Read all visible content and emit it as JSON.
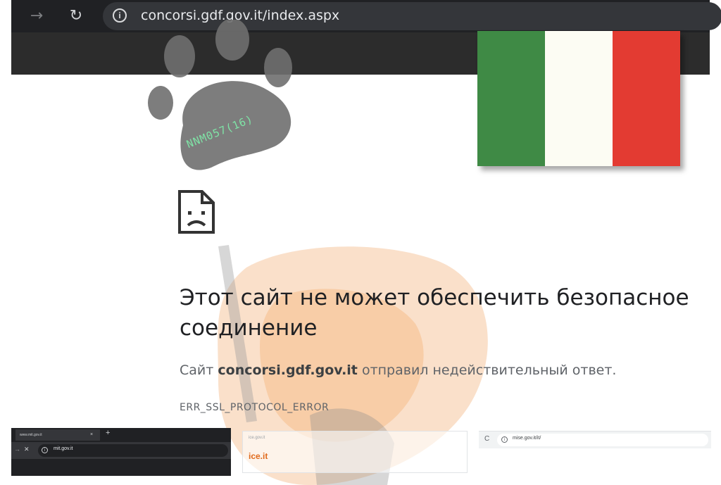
{
  "browser": {
    "url": "concorsi.gdf.gov.it/index.aspx",
    "info_glyph": "i",
    "forward_glyph": "→",
    "reload_glyph": "↻"
  },
  "watermark": {
    "code": "NNM057(16)",
    "paw_color": "#6f6f6f"
  },
  "flag": {
    "colors": [
      "#3f8a45",
      "#fcfcf3",
      "#e33b32"
    ]
  },
  "error_page": {
    "icon": "sad-page-icon",
    "title": "Этот сайт не может обеспечить безопасное соединение",
    "desc_prefix": "Сайт ",
    "desc_host": "concorsi.gdf.gov.it",
    "desc_suffix": " отправил недействительный ответ.",
    "error_code": "ERR_SSL_PROTOCOL_ERROR"
  },
  "insets": {
    "left": {
      "tab_title": "www.mit.gov.it",
      "tab_close": "×",
      "new_tab": "+",
      "back_glyph": "→",
      "stop_glyph": "✕",
      "url": "mit.gov.it"
    },
    "middle": {
      "url": "ice.gov.it",
      "logo": "ice.it"
    },
    "right": {
      "reload_glyph": "C",
      "url": "mise.gov.it/it/"
    }
  }
}
